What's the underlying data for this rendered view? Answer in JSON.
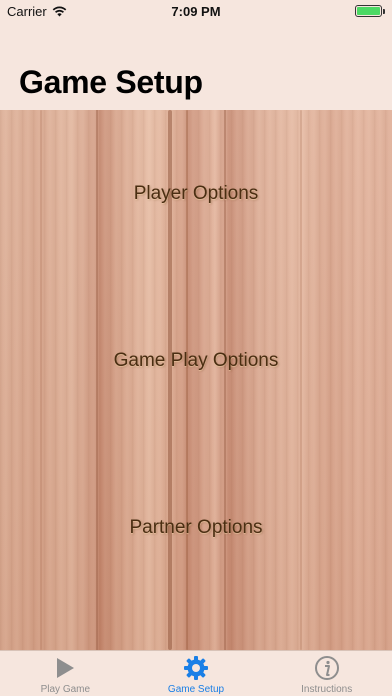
{
  "status_bar": {
    "carrier": "Carrier",
    "time": "7:09 PM",
    "battery_percent": 100
  },
  "header": {
    "title": "Game Setup"
  },
  "options": {
    "player": "Player Options",
    "game_play": "Game Play Options",
    "partner": "Partner Options"
  },
  "tab_bar": {
    "tabs": [
      {
        "label": "Play Game",
        "icon": "play-icon",
        "active": false
      },
      {
        "label": "Game Setup",
        "icon": "gear-icon",
        "active": true
      },
      {
        "label": "Instructions",
        "icon": "info-icon",
        "active": false
      }
    ]
  },
  "colors": {
    "accent": "#1a7fe6",
    "inactive_tab": "#8e8e8e",
    "option_text": "#4a2e12",
    "bar_background": "#f6e6de"
  }
}
